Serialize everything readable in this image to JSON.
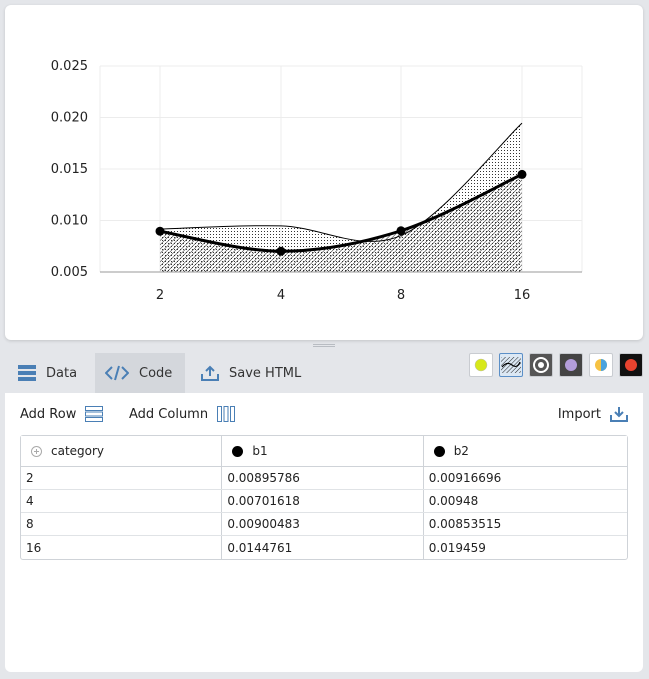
{
  "chart_data": {
    "type": "area",
    "categories": [
      "2",
      "4",
      "8",
      "16"
    ],
    "series": [
      {
        "name": "b1",
        "values": [
          0.00895786,
          0.00701618,
          0.00900483,
          0.0144761
        ]
      },
      {
        "name": "b2",
        "values": [
          0.00916696,
          0.00948,
          0.00853515,
          0.019459
        ]
      }
    ],
    "y_ticks": [
      "0.005",
      "0.010",
      "0.015",
      "0.020",
      "0.025"
    ],
    "ylim": [
      0.005,
      0.025
    ],
    "grid": true,
    "title": "",
    "xlabel": "",
    "ylabel": ""
  },
  "tabs": [
    {
      "label": "Data",
      "icon": "table-icon"
    },
    {
      "label": "Code",
      "icon": "code-icon"
    },
    {
      "label": "Save HTML",
      "icon": "upload-icon"
    }
  ],
  "themes": [
    "theme-lime-icon",
    "theme-hatched-icon",
    "theme-dark-ring-icon",
    "theme-purple-icon",
    "theme-yellow-blue-icon",
    "theme-red-icon"
  ],
  "toolbar": {
    "add_row": "Add Row",
    "add_column": "Add Column",
    "import": "Import"
  },
  "table": {
    "columns": [
      "category",
      "b1",
      "b2"
    ],
    "rows": [
      [
        "2",
        "0.00895786",
        "0.00916696"
      ],
      [
        "4",
        "0.00701618",
        "0.00948"
      ],
      [
        "8",
        "0.00900483",
        "0.00853515"
      ],
      [
        "16",
        "0.0144761",
        "0.019459"
      ]
    ]
  },
  "colors": {
    "accent": "#5b8fc7",
    "series_line": "#000000"
  }
}
